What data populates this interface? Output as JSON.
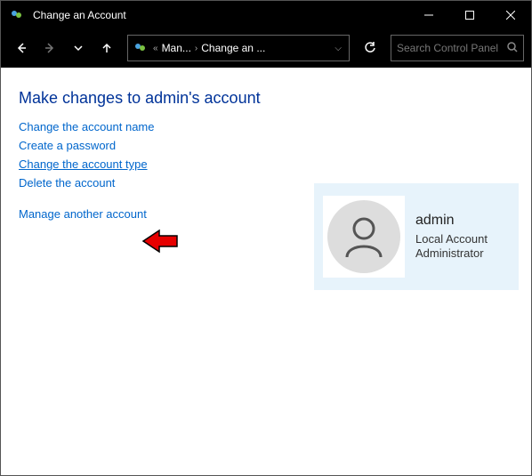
{
  "window": {
    "title": "Change an Account"
  },
  "breadcrumb": {
    "seg1": "Man...",
    "seg2": "Change an ..."
  },
  "search": {
    "placeholder": "Search Control Panel"
  },
  "heading": "Make changes to admin's account",
  "links": {
    "change_name": "Change the account name",
    "create_password": "Create a password",
    "change_type": "Change the account type",
    "delete_account": "Delete the account",
    "manage_another": "Manage another account"
  },
  "user": {
    "name": "admin",
    "line1": "Local Account",
    "line2": "Administrator"
  }
}
